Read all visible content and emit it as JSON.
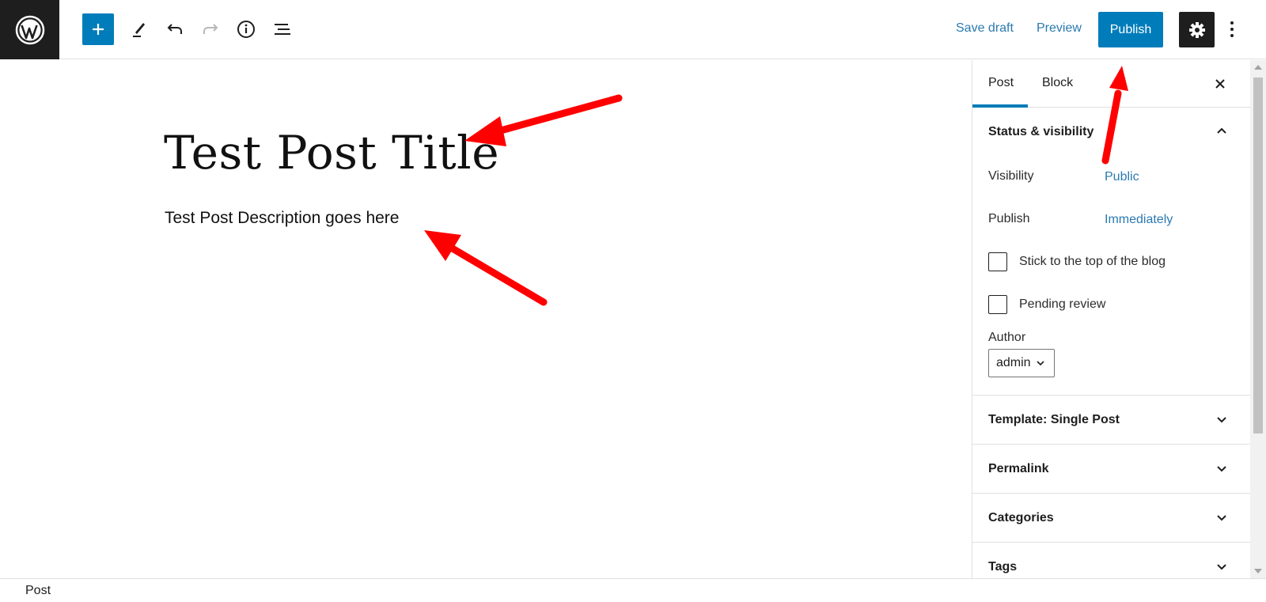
{
  "toolbar": {
    "add_icon": "plus-icon",
    "edit_icon": "pencil-icon",
    "undo_icon": "undo-icon",
    "redo_icon": "redo-icon",
    "info_icon": "info-icon",
    "list_icon": "list-view-icon",
    "save_draft": "Save draft",
    "preview": "Preview",
    "publish": "Publish",
    "settings_icon": "gear-icon",
    "more_icon": "more-vertical-icon"
  },
  "editor": {
    "title": "Test Post Title",
    "description": "Test Post Description goes here"
  },
  "sidebar": {
    "tabs": [
      {
        "label": "Post",
        "active": true
      },
      {
        "label": "Block",
        "active": false
      }
    ],
    "status_visibility": {
      "title": "Status & visibility",
      "visibility_label": "Visibility",
      "visibility_value": "Public",
      "publish_label": "Publish",
      "publish_value": "Immediately",
      "stick_label": "Stick to the top of the blog",
      "pending_label": "Pending review",
      "author_label": "Author",
      "author_value": "admin"
    },
    "panels": [
      {
        "title": "Template: Single Post"
      },
      {
        "title": "Permalink"
      },
      {
        "title": "Categories"
      },
      {
        "title": "Tags"
      }
    ]
  },
  "footer": {
    "breadcrumb": "Post"
  },
  "colors": {
    "accent": "#007cba",
    "dark": "#1e1e1e",
    "link": "#2a7ab0",
    "annotation": "#ff0000"
  }
}
